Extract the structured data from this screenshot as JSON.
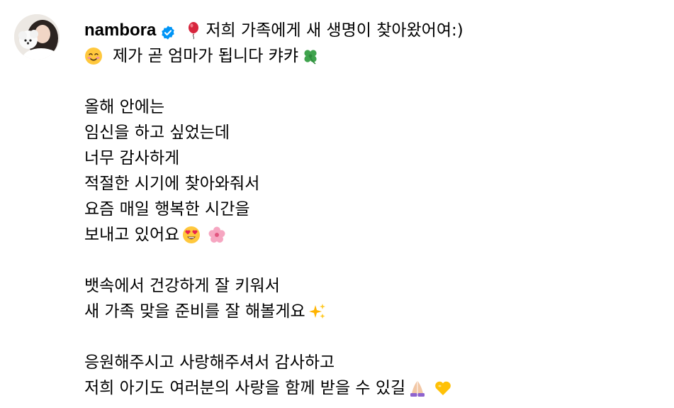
{
  "post": {
    "username": "nambora",
    "verified_color": "#0095f6",
    "icons": {
      "verified": "verified-badge-icon",
      "balloon": "balloon-emoji",
      "smile": "smiling-face-emoji",
      "clover": "four-leaf-clover-emoji",
      "heart_eyes": "heart-eyes-emoji",
      "blossom": "cherry-blossom-emoji",
      "sparkles": "sparkles-emoji",
      "pray": "folded-hands-emoji",
      "yellow_heart": "yellow-heart-emoji"
    },
    "caption": {
      "line1": "저희 가족에게 새 생명이 찾아왔어여:)",
      "line2": "제가 곧 엄마가 됩니다 캬캬",
      "line3": "올해 안에는",
      "line4": "임신을 하고 싶었는데",
      "line5": "너무 감사하게",
      "line6": "적절한 시기에 찾아와줘서",
      "line7": "요즘 매일 행복한 시간을",
      "line8": "보내고 있어요",
      "line9": "뱃속에서 건강하게 잘 키워서",
      "line10": "새 가족 맞을 준비를 잘 해볼게요",
      "line11": "응원해주시고 사랑해주셔서 감사하고",
      "line12": "저희 아기도 여러분의 사랑을 함께 받을 수 있길"
    }
  }
}
